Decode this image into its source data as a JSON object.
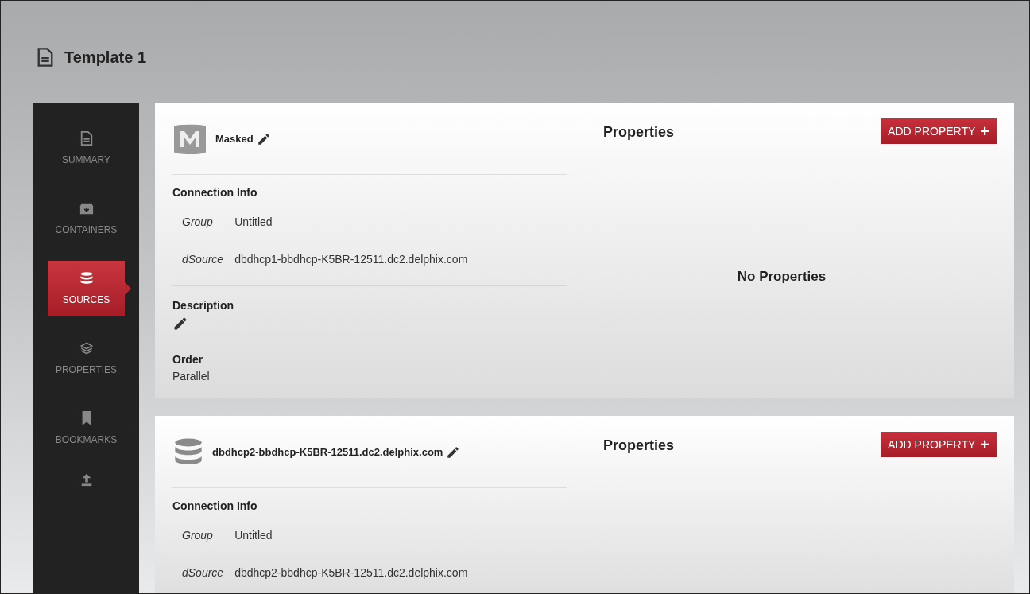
{
  "page": {
    "title": "Template 1"
  },
  "sidebar": {
    "items": [
      {
        "label": "SUMMARY",
        "selected": false
      },
      {
        "label": "CONTAINERS",
        "selected": false
      },
      {
        "label": "SOURCES",
        "selected": true
      },
      {
        "label": "PROPERTIES",
        "selected": false
      },
      {
        "label": "BOOKMARKS",
        "selected": false
      }
    ]
  },
  "sources": [
    {
      "kind": "masked",
      "name": "Masked",
      "connection_title": "Connection Info",
      "fields": [
        {
          "label": "Group",
          "value": "Untitled"
        },
        {
          "label": "dSource",
          "value": "dbdhcp1-bbdhcp-K5BR-12511.dc2.delphix.com"
        }
      ],
      "description_title": "Description",
      "order_title": "Order",
      "order_value": "Parallel",
      "properties_title": "Properties",
      "add_button": "ADD PROPERTY",
      "add_icon": "+",
      "empty_text": "No Properties"
    },
    {
      "kind": "database",
      "name": "dbdhcp2-bbdhcp-K5BR-12511.dc2.delphix.com",
      "connection_title": "Connection Info",
      "fields": [
        {
          "label": "Group",
          "value": "Untitled"
        },
        {
          "label": "dSource",
          "value": "dbdhcp2-bbdhcp-K5BR-12511.dc2.delphix.com"
        }
      ],
      "properties_title": "Properties",
      "add_button": "ADD PROPERTY",
      "add_icon": "+"
    }
  ]
}
